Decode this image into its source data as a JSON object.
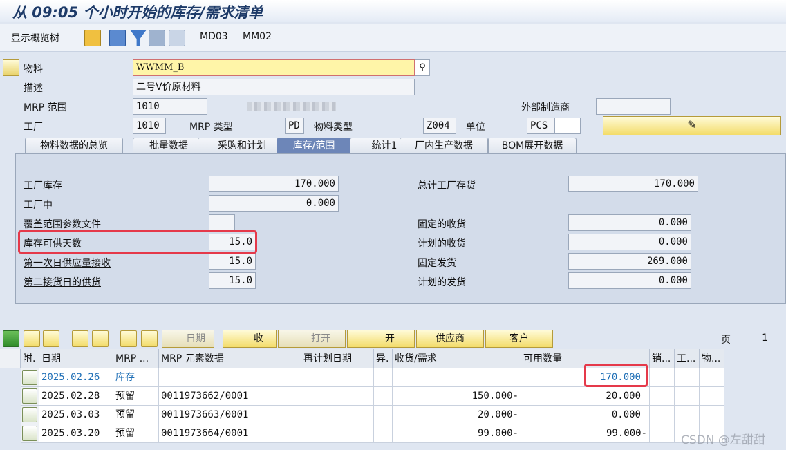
{
  "window": {
    "title": "从 09:05 个小时开始的库存/需求清单"
  },
  "toolbar": {
    "overview_tree": "显示概览树",
    "md03": "MD03",
    "mm02": "MM02"
  },
  "header": {
    "material_label": "物料",
    "material_value": "WWMM_B",
    "desc_label": "描述",
    "desc_value": "二号V价原材料",
    "mrp_area_label": "MRP 范围",
    "mrp_area_value": "1010",
    "plant_label": "工厂",
    "plant_value": "1010",
    "mrp_type_label": "MRP 类型",
    "mrp_type_value": "PD",
    "mat_type_label": "物料类型",
    "mat_type_value": "Z004",
    "unit_label": "单位",
    "unit_value": "PCS",
    "ext_mfr_label": "外部制造商",
    "ext_mfr_value": ""
  },
  "tabs": [
    "物料数据的总览",
    "批量数据",
    "采购和计划",
    "库存/范围",
    "统计1",
    "厂内生产数据",
    "BOM展开数据"
  ],
  "stock": {
    "plant_stock_label": "工厂库存",
    "plant_stock": "170.000",
    "in_plant_label": "工厂中",
    "in_plant": "0.000",
    "coverage_profile_label": "覆盖范围参数文件",
    "coverage_profile": "",
    "days_supply_label": "库存可供天数",
    "days_supply": "15.0",
    "first_receipt_label": "第一次日供应量接收",
    "first_receipt": "15.0",
    "second_receipt_label": "第二接货日的供货",
    "second_receipt": "15.0",
    "total_plant_label": "总计工厂存货",
    "total_plant": "170.000",
    "firm_receipts_label": "固定的收货",
    "firm_receipts": "0.000",
    "planned_receipts_label": "计划的收货",
    "planned_receipts": "0.000",
    "firm_issues_label": "固定发货",
    "firm_issues": "269.000",
    "planned_issues_label": "计划的发货",
    "planned_issues": "0.000"
  },
  "grid_toolbar": {
    "date_btn": "日期",
    "receipts_btn": "收",
    "open_btn": "打开",
    "on_btn": "开",
    "vendor_btn": "供应商",
    "customer_btn": "客户",
    "page_label": "页",
    "page_value": "1"
  },
  "grid": {
    "columns": [
      "附.",
      "日期",
      "MRP ...",
      "MRP 元素数据",
      "再计划日期",
      "异.",
      "收货/需求",
      "可用数量",
      "销...",
      "工...",
      "物..."
    ],
    "rows": [
      {
        "date": "2025.02.26",
        "mrp": "库存",
        "element": "",
        "receipt": "",
        "available": "170.000"
      },
      {
        "date": "2025.02.28",
        "mrp": "预留",
        "element": "0011973662/0001",
        "receipt": "150.000-",
        "available": "20.000"
      },
      {
        "date": "2025.03.03",
        "mrp": "预留",
        "element": "0011973663/0001",
        "receipt": "20.000-",
        "available": "0.000"
      },
      {
        "date": "2025.03.20",
        "mrp": "预留",
        "element": "0011973664/0001",
        "receipt": "99.000-",
        "available": "99.000-"
      }
    ]
  },
  "watermark": "CSDN @左甜甜"
}
